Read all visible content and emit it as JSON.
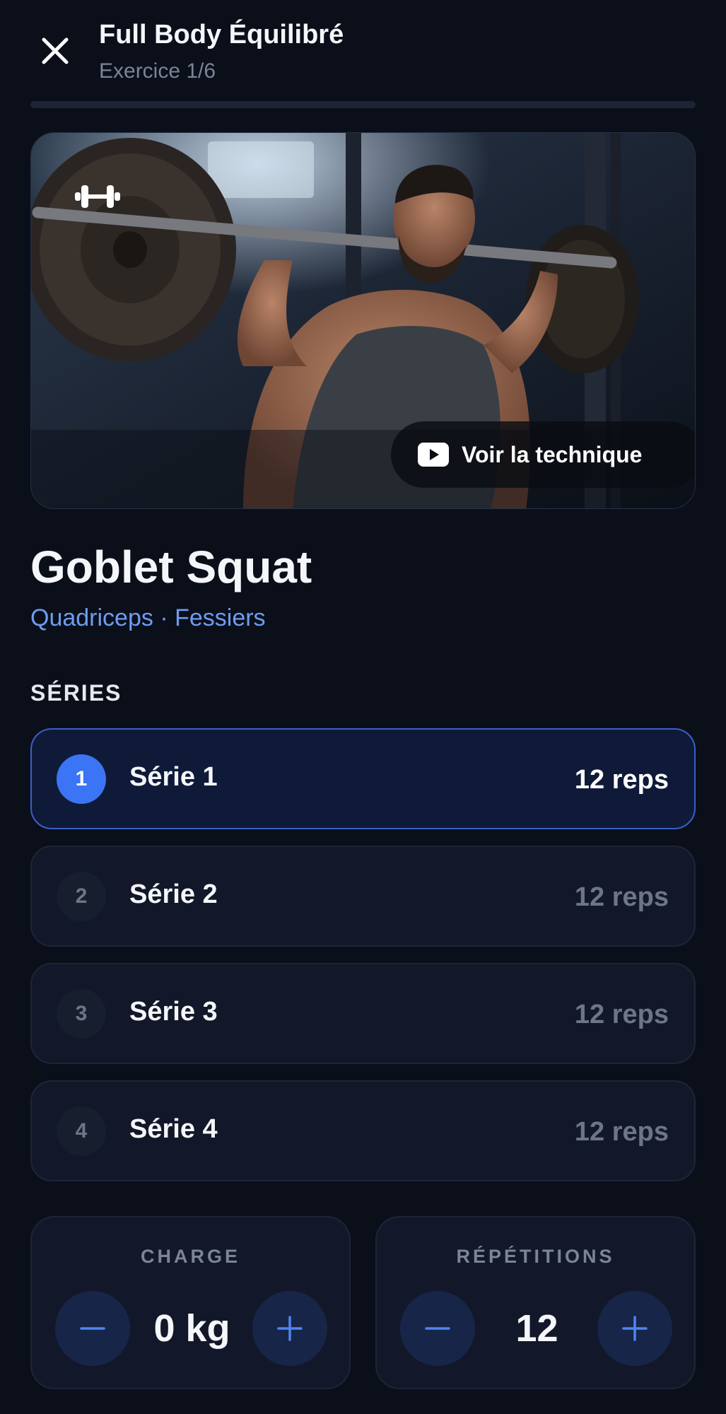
{
  "header": {
    "title": "Full Body Équilibré",
    "subtitle": "Exercice 1/6",
    "progress_fraction": 0.0
  },
  "media": {
    "icon": "dumbbell-icon",
    "technique_label": "Voir la technique",
    "technique_icon": "youtube-play-icon"
  },
  "exercise": {
    "name": "Goblet Squat",
    "muscles": "Quadriceps · Fessiers"
  },
  "series": {
    "section_label": "SÉRIES",
    "items": [
      {
        "number": "1",
        "name": "Série 1",
        "reps": "12 reps",
        "active": true
      },
      {
        "number": "2",
        "name": "Série 2",
        "reps": "12 reps",
        "active": false
      },
      {
        "number": "3",
        "name": "Série 3",
        "reps": "12 reps",
        "active": false
      },
      {
        "number": "4",
        "name": "Série 4",
        "reps": "12 reps",
        "active": false
      }
    ]
  },
  "controls": {
    "charge": {
      "label": "CHARGE",
      "value": "0 kg"
    },
    "repetitions": {
      "label": "RÉPÉTITIONS",
      "value": "12"
    }
  },
  "colors": {
    "background": "#0b0f1a",
    "accent": "#3b74f5",
    "muscle_text": "#6f9cf0",
    "card": "#121829"
  }
}
